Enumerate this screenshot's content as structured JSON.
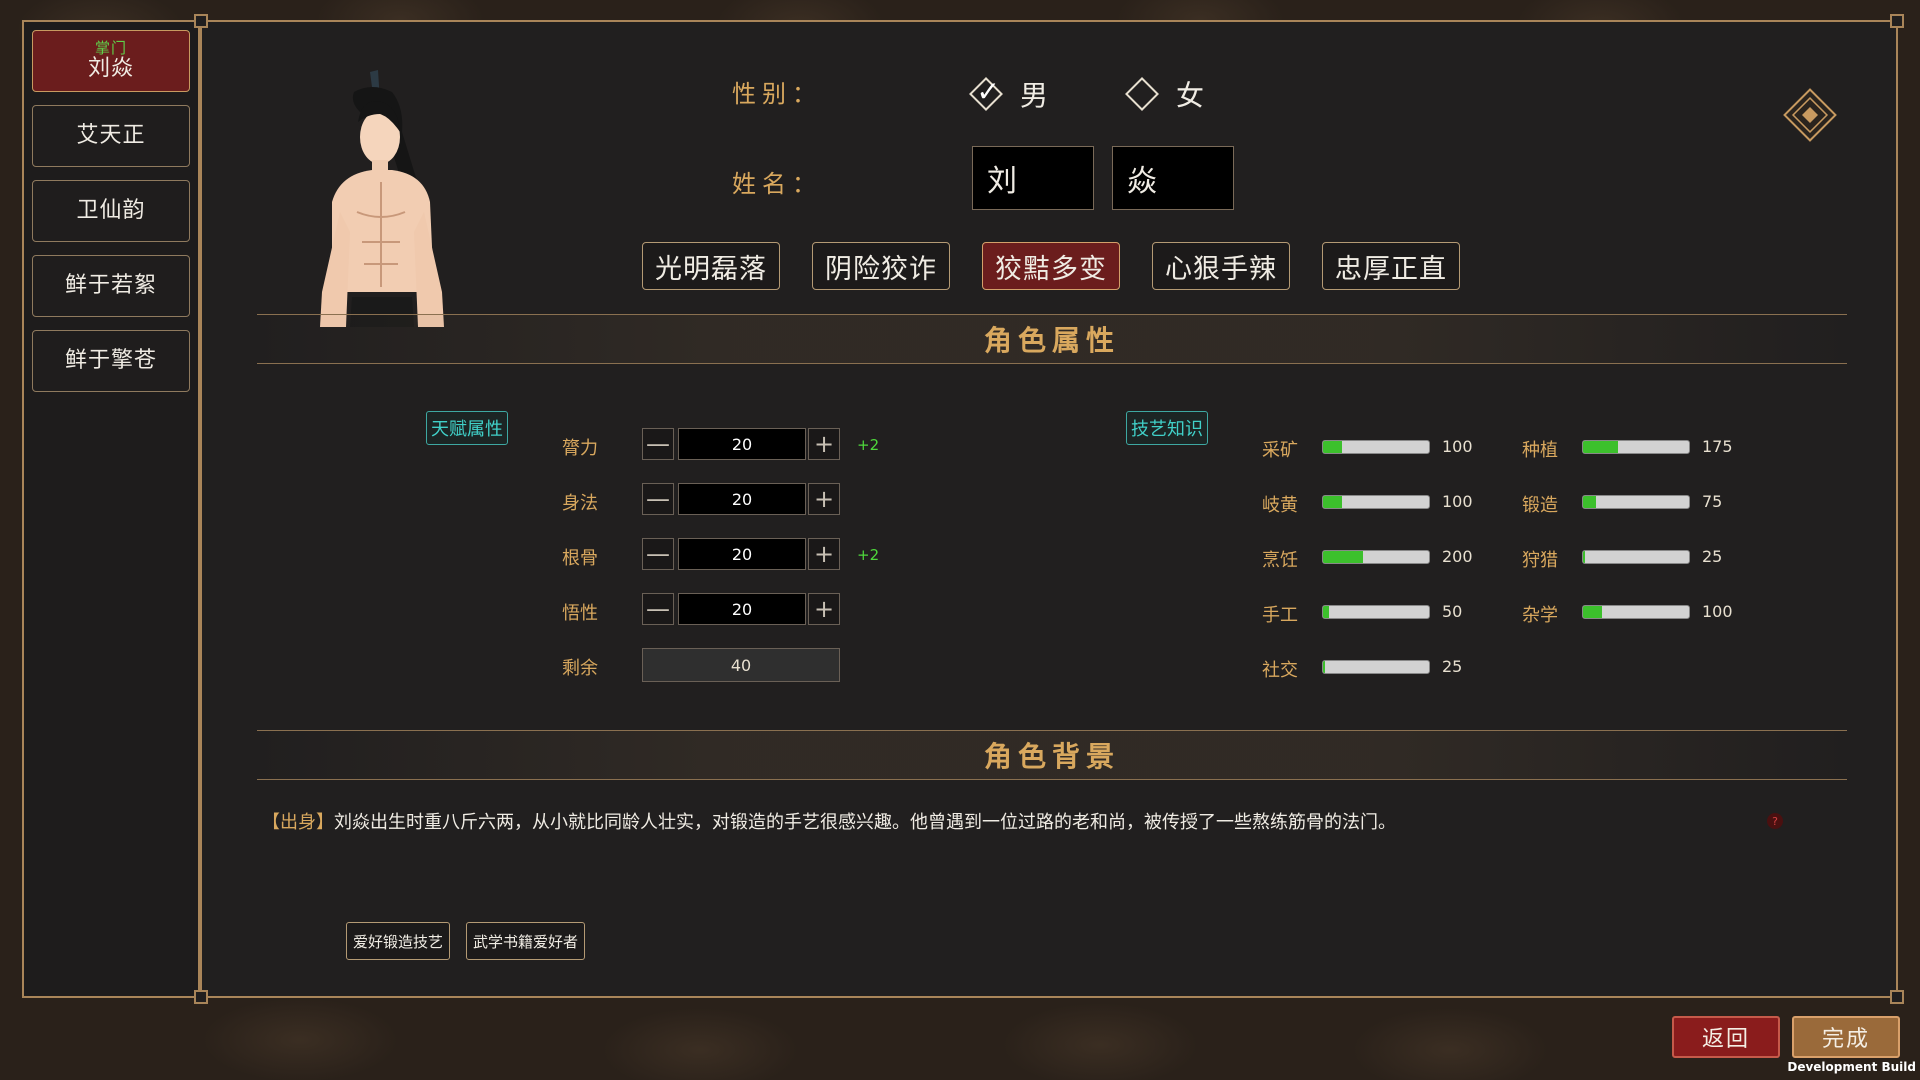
{
  "sidebar": {
    "members": [
      {
        "role": "掌门",
        "name": "刘焱",
        "active": true
      },
      {
        "role": "",
        "name": "艾天正"
      },
      {
        "role": "",
        "name": "卫仙韵"
      },
      {
        "role": "",
        "name": "鲜于若絮"
      },
      {
        "role": "",
        "name": "鲜于擎苍"
      }
    ]
  },
  "gender": {
    "label": "性别：",
    "options": [
      "男",
      "女"
    ],
    "selected": "男"
  },
  "name": {
    "label": "姓名：",
    "surname": "刘",
    "given": "焱"
  },
  "traits": {
    "items": [
      "光明磊落",
      "阴险狡诈",
      "狡黠多变",
      "心狠手辣",
      "忠厚正直"
    ],
    "selected": "狡黠多变"
  },
  "sections": {
    "attributes_title": "角色属性",
    "background_title": "角色背景"
  },
  "attributes": {
    "tag": "天赋属性",
    "minus": "—",
    "plus": "+",
    "items": [
      {
        "label": "膂力",
        "value": "20",
        "bonus": "+2"
      },
      {
        "label": "身法",
        "value": "20",
        "bonus": ""
      },
      {
        "label": "根骨",
        "value": "20",
        "bonus": "+2"
      },
      {
        "label": "悟性",
        "value": "20",
        "bonus": ""
      }
    ],
    "remaining_label": "剩余",
    "remaining_value": "40"
  },
  "skills": {
    "tag": "技艺知识",
    "left": [
      {
        "label": "采矿",
        "value": "100",
        "fill": 0.18
      },
      {
        "label": "岐黄",
        "value": "100",
        "fill": 0.18
      },
      {
        "label": "烹饪",
        "value": "200",
        "fill": 0.38
      },
      {
        "label": "手工",
        "value": "50",
        "fill": 0.06
      },
      {
        "label": "社交",
        "value": "25",
        "fill": 0.02
      }
    ],
    "right": [
      {
        "label": "种植",
        "value": "175",
        "fill": 0.33
      },
      {
        "label": "锻造",
        "value": "75",
        "fill": 0.12
      },
      {
        "label": "狩猎",
        "value": "25",
        "fill": 0.02
      },
      {
        "label": "杂学",
        "value": "100",
        "fill": 0.18
      }
    ]
  },
  "background": {
    "tag": "【出身】",
    "text": "刘焱出生时重八斤六两，从小就比同龄人壮实，对锻造的手艺很感兴趣。他曾遇到一位过路的老和尚，被传授了一些熬练筋骨的法门。",
    "help": "?",
    "hobbies": [
      "爱好锻造技艺",
      "武学书籍爱好者"
    ]
  },
  "buttons": {
    "back": "返回",
    "done": "完成"
  },
  "footer": {
    "build": "Development Build"
  },
  "colors": {
    "accent_gold": "#d9a85e",
    "active_red": "#6b1d1d",
    "bar_green": "#3cc02c",
    "tag_cyan": "#40d0c8",
    "bonus_green": "#4ed83c"
  }
}
